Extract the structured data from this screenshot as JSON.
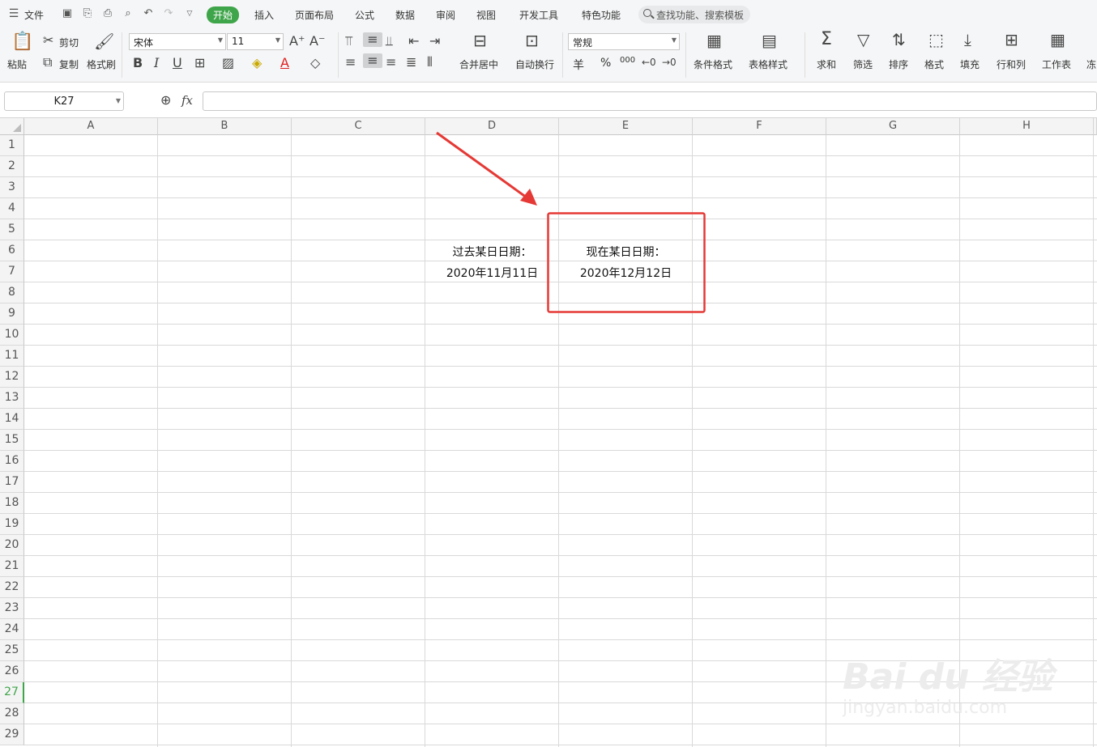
{
  "menu": {
    "file": "文件",
    "tabs": [
      "开始",
      "插入",
      "页面布局",
      "公式",
      "数据",
      "审阅",
      "视图",
      "开发工具",
      "特色功能"
    ],
    "search_placeholder": "查找功能、搜索模板"
  },
  "ribbon": {
    "paste": "粘贴",
    "cut": "剪切",
    "copy": "复制",
    "format_painter": "格式刷",
    "font_name": "宋体",
    "font_size": "11",
    "bold": "B",
    "italic": "I",
    "underline": "U",
    "merge_center": "合并居中",
    "wrap_text": "自动换行",
    "number_format": "常规",
    "currency": "羊",
    "percent": "%",
    "thousands": "000",
    "conditional_format": "条件格式",
    "table_style": "表格样式",
    "sum": "求和",
    "filter": "筛选",
    "sort": "排序",
    "format": "格式",
    "fill": "填充",
    "row_col": "行和列",
    "worksheet": "工作表",
    "freeze": "冻"
  },
  "formula_bar": {
    "name_box": "K27",
    "fx": "fx",
    "formula": ""
  },
  "sheet": {
    "columns": [
      "A",
      "B",
      "C",
      "D",
      "E",
      "F",
      "G",
      "H"
    ],
    "rows": [
      "1",
      "2",
      "3",
      "4",
      "5",
      "6",
      "7",
      "8",
      "9",
      "10",
      "11",
      "12",
      "13",
      "14",
      "15",
      "16",
      "17",
      "18",
      "19",
      "20",
      "21",
      "22",
      "23",
      "24",
      "25",
      "26",
      "27",
      "28",
      "29"
    ],
    "selected_row": "27",
    "cells": {
      "D6": "过去某日日期：",
      "D7": "2020年11月11日",
      "E6": "现在某日日期：",
      "E7": "2020年12月12日"
    }
  },
  "annotation_color": "#e53935",
  "accent_color": "#3fa54a",
  "watermark": {
    "brand": "Bai du 经验",
    "url": "jingyan.baidu.com"
  }
}
